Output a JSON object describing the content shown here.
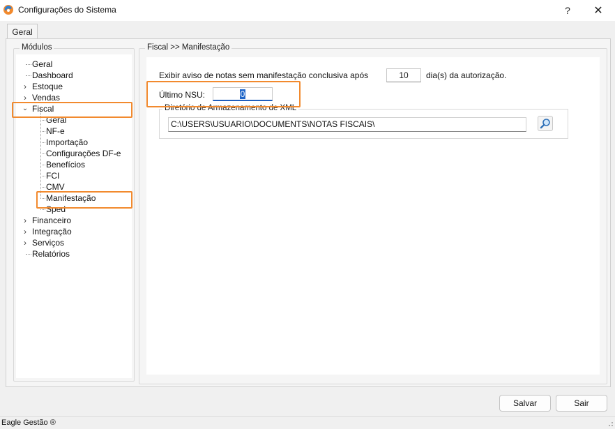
{
  "window": {
    "title": "Configurações do Sistema",
    "help_label": "?",
    "close_label": "✕"
  },
  "tab": {
    "label": "Geral"
  },
  "modules": {
    "title": "Módulos",
    "items": [
      {
        "label": "Geral"
      },
      {
        "label": "Dashboard"
      },
      {
        "label": "Estoque"
      },
      {
        "label": "Vendas"
      },
      {
        "label": "Fiscal"
      },
      {
        "label": "Geral"
      },
      {
        "label": "NF-e"
      },
      {
        "label": "Importação"
      },
      {
        "label": "Configurações DF-e"
      },
      {
        "label": "Benefícios"
      },
      {
        "label": "FCI"
      },
      {
        "label": "CMV"
      },
      {
        "label": "Manifestação"
      },
      {
        "label": "Sped"
      },
      {
        "label": "Financeiro"
      },
      {
        "label": "Integração"
      },
      {
        "label": "Serviços"
      },
      {
        "label": "Relatórios"
      }
    ]
  },
  "content": {
    "group_title": "Fiscal >> Manifestação",
    "warning_label": "Exibir aviso de notas sem manifestação conclusiva após",
    "warning_days_value": "10",
    "warning_suffix": "dia(s) da autorização.",
    "nsu_label": "Último NSU:",
    "nsu_value": "0",
    "xml_group_title": "Diretório de Armazenamento de XML",
    "xml_path_value": "C:\\USERS\\USUARIO\\DOCUMENTS\\NOTAS FISCAIS\\"
  },
  "buttons": {
    "save_label": "Salvar",
    "exit_label": "Sair"
  },
  "status": {
    "text": "Eagle Gestão ®"
  },
  "colors": {
    "highlight": "#f28a2e",
    "selection": "#1f66c8"
  },
  "icons": {
    "app": "app-logo-icon",
    "expand": "chevron-right-icon",
    "collapse": "chevron-down-icon",
    "search": "magnifier-icon"
  }
}
